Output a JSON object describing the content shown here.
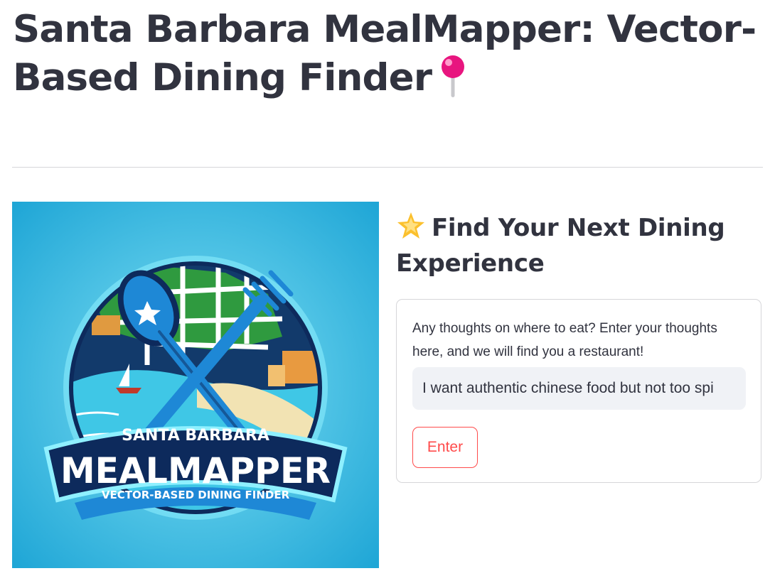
{
  "header": {
    "title": "Santa Barbara MealMapper: Vector-Based Dining Finder",
    "title_icon": "round-pushpin-icon"
  },
  "logo": {
    "line_top": "SANTA BARBARA",
    "line_main": "MEALMAPPER",
    "line_sub": "VECTOR-BASED DINING FINDER",
    "colors": {
      "background": "#2fb4dc",
      "navy": "#0d2a5c",
      "water": "#3fc7e6",
      "ribbon": "#1e88d6"
    }
  },
  "search": {
    "heading": "Find Your Next Dining Experience",
    "heading_icon": "glowing-star-icon",
    "prompt": "Any thoughts on where to eat? Enter your thoughts here, and we will find you a restaurant!",
    "value": "I want authentic chinese food but not too spi",
    "submit_label": "Enter"
  },
  "colors": {
    "text": "#31333f",
    "accent": "#ff4b4b",
    "input_bg": "#f0f2f6",
    "border": "#d6d6d9"
  }
}
